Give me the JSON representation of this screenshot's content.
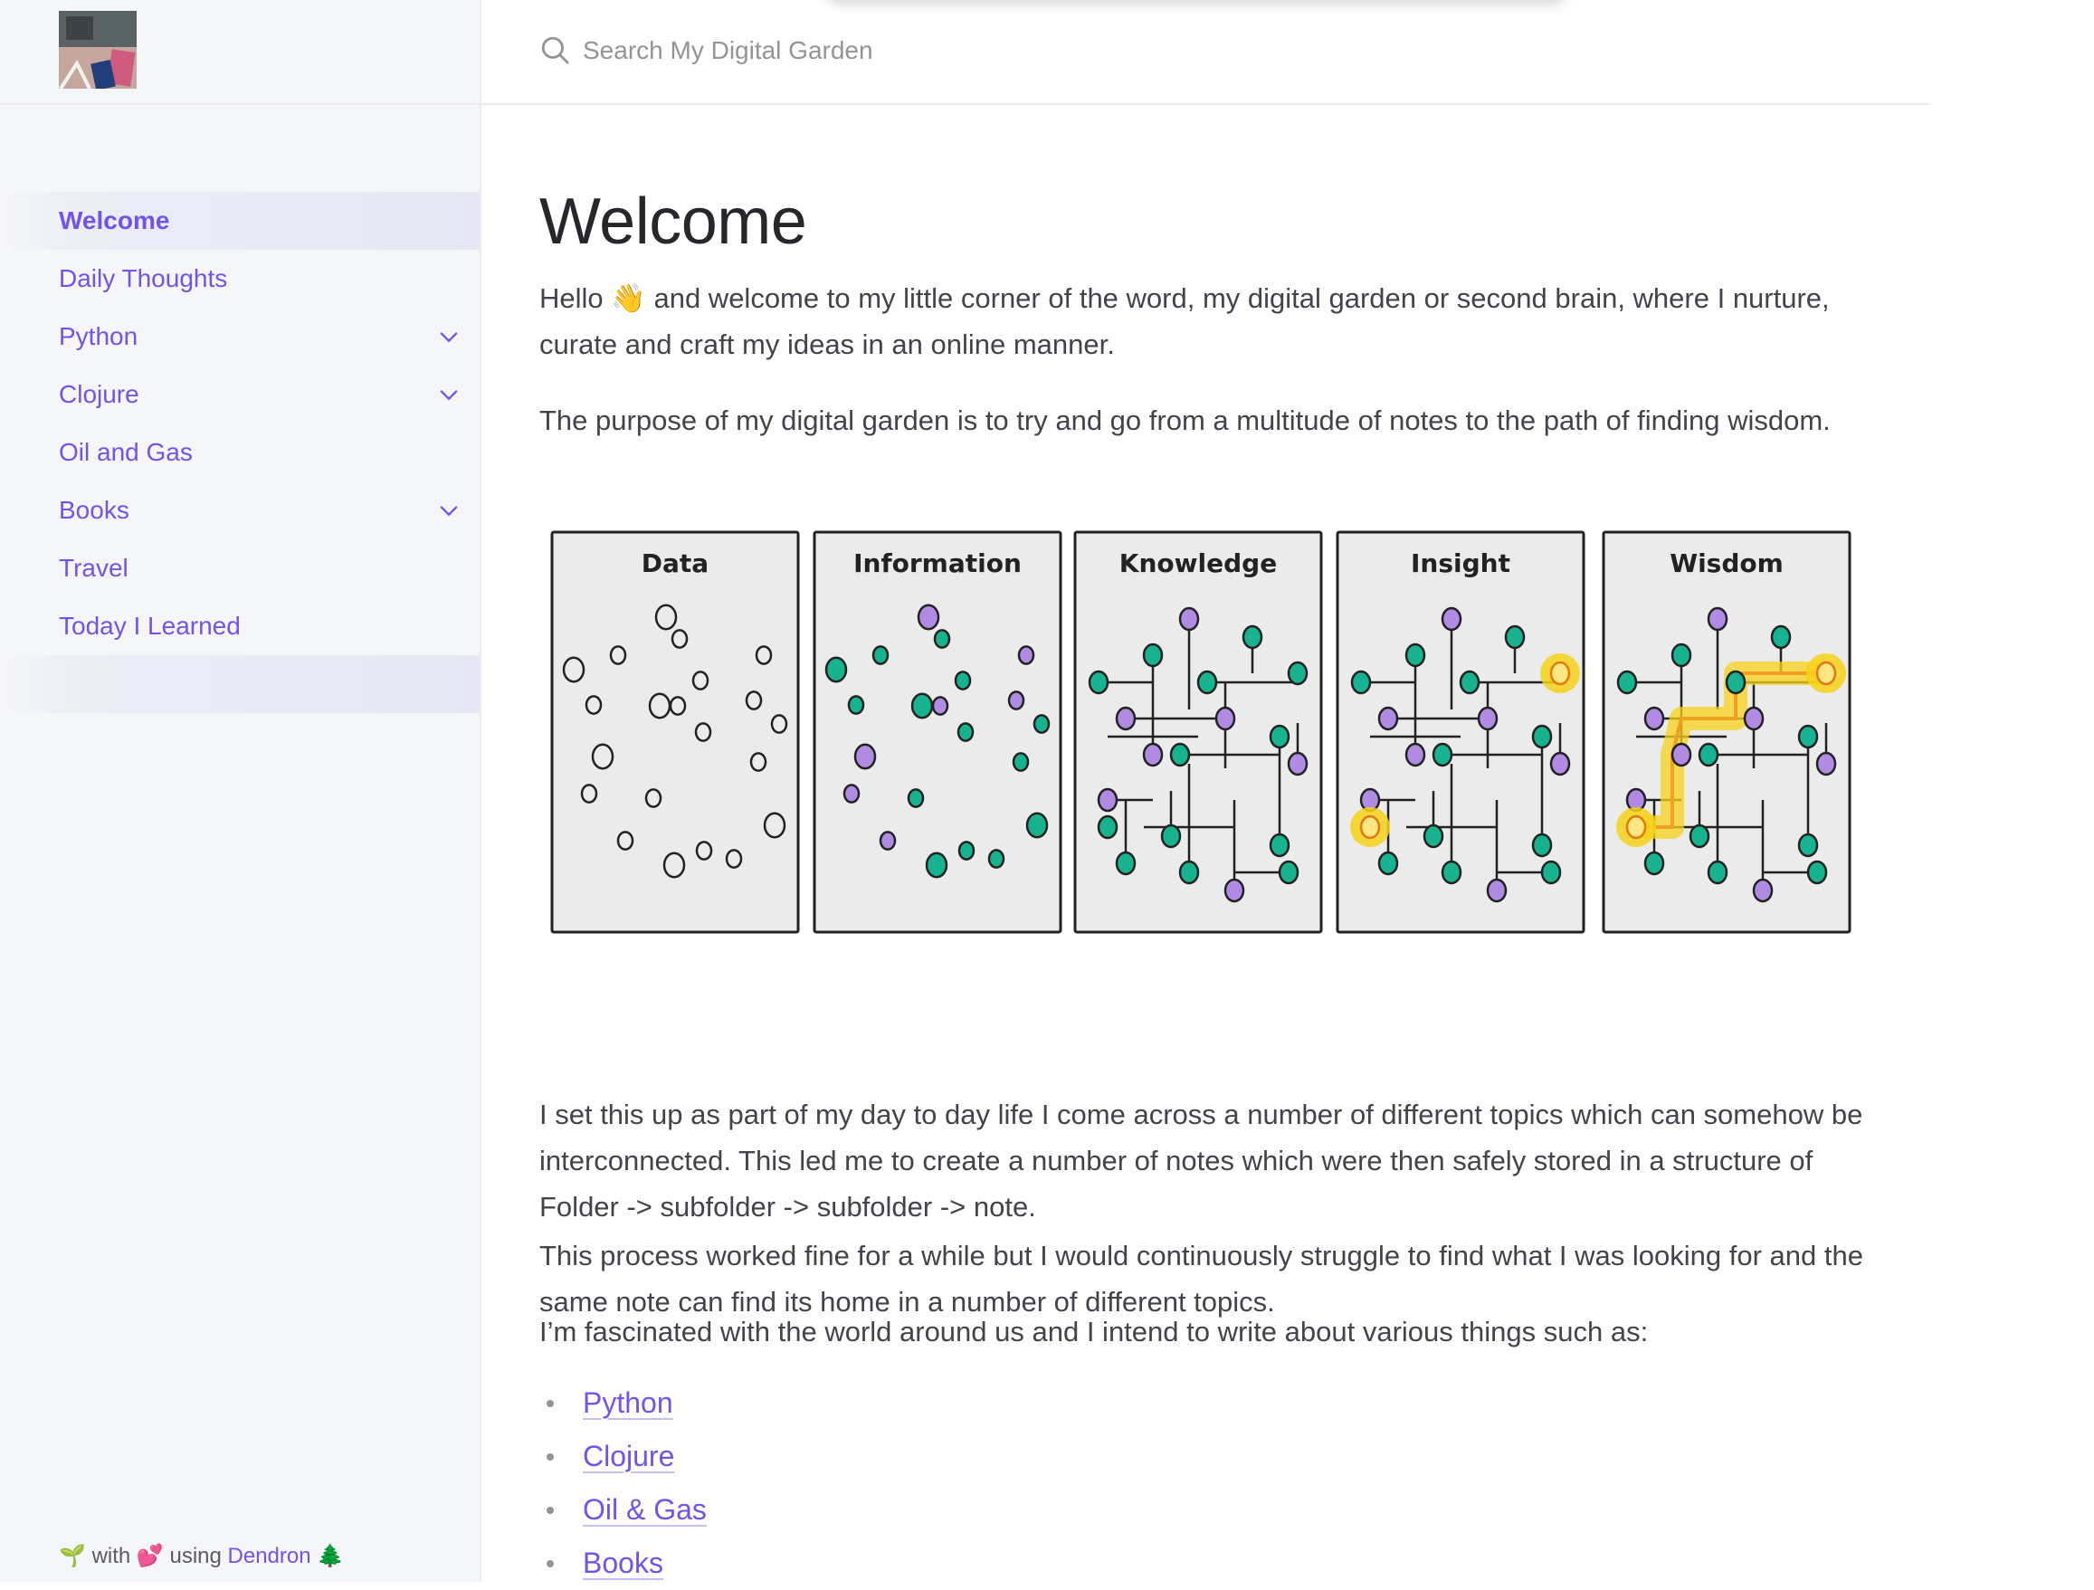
{
  "sidebar": {
    "nav": [
      {
        "label": "Welcome",
        "active": true,
        "expandable": false
      },
      {
        "label": "Daily Thoughts",
        "expandable": false
      },
      {
        "label": "Python",
        "expandable": true
      },
      {
        "label": "Clojure",
        "expandable": true
      },
      {
        "label": "Oil and Gas",
        "expandable": false
      },
      {
        "label": "Books",
        "expandable": true
      },
      {
        "label": "Travel",
        "expandable": false
      },
      {
        "label": "Today I Learned",
        "expandable": false
      }
    ],
    "footer": {
      "sprout": "🌱",
      "with": "with",
      "heart": "💕",
      "using": "using",
      "link": "Dendron",
      "tree": "🌲"
    }
  },
  "search": {
    "placeholder": "Search My Digital Garden"
  },
  "main": {
    "title": "Welcome",
    "paragraphs": [
      "Hello 👋 and welcome to my little corner of the word, my digital garden or second brain, where I nurture, curate and craft my ideas in an online manner.",
      "The purpose of my digital garden is to try and go from a multitude of notes to the path of finding wisdom.",
      "I set this up as part of my day to day life I come across a number of different topics which can somehow be interconnected. This led me to create a number of notes which were then safely stored in a structure of Folder -> subfolder -> subfolder -> note.",
      "This process worked fine for a while but I would continuously struggle to find what I was looking for and the same note can find its home in a number of different topics.",
      "I’m fascinated with the world around us and I intend to write about various things such as:"
    ],
    "figure_panels": [
      "Data",
      "Information",
      "Knowledge",
      "Insight",
      "Wisdom"
    ],
    "bullets": [
      "Python",
      "Clojure",
      "Oil & Gas",
      "Books"
    ]
  },
  "colors": {
    "accent": "#7253ed",
    "sidebar_bg": "#f5f6fa",
    "teal": "#16b38e",
    "lilac": "#b18ae3",
    "highlight": "#f7d219"
  }
}
